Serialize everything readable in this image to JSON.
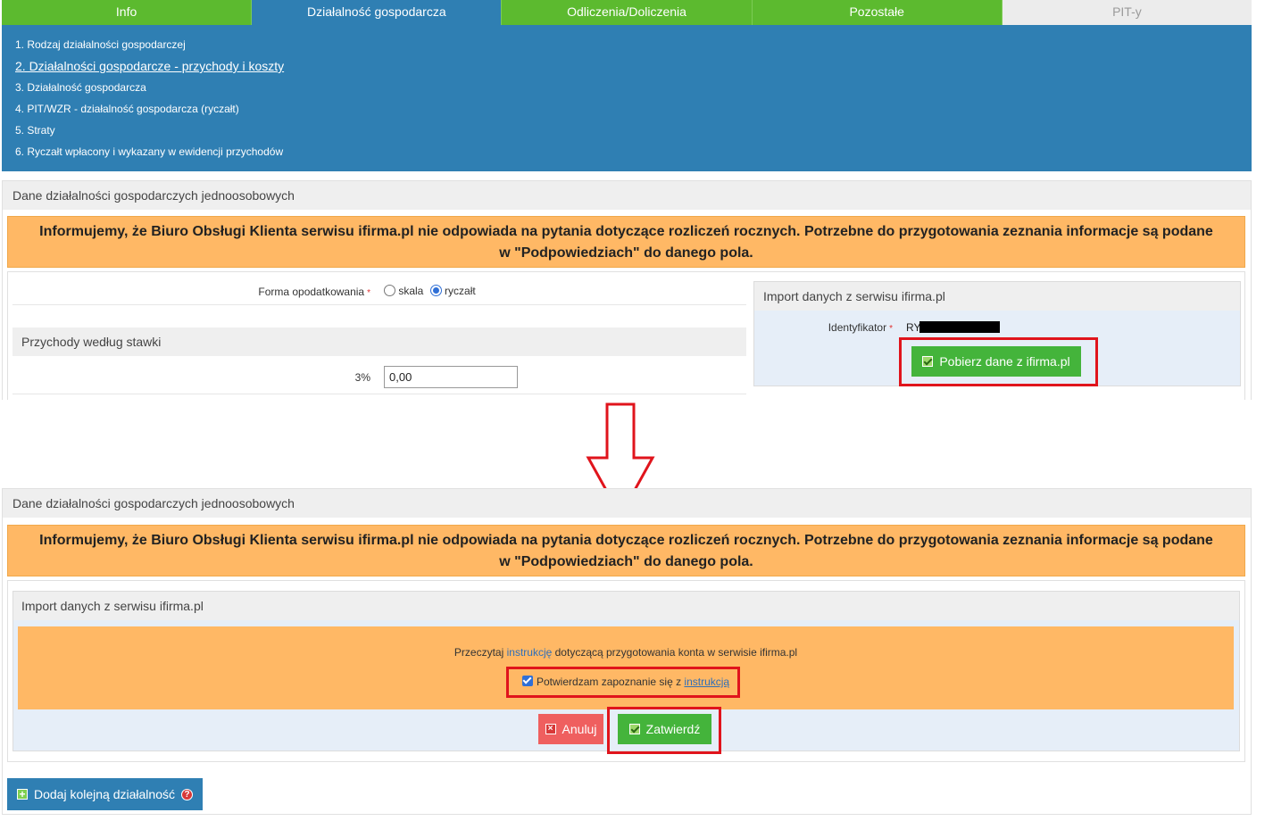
{
  "tabs": [
    {
      "label": "Info"
    },
    {
      "label": "Działalność gospodarcza"
    },
    {
      "label": "Odliczenia/Doliczenia"
    },
    {
      "label": "Pozostałe"
    },
    {
      "label": "PIT-y"
    }
  ],
  "subnav": [
    {
      "label": "1. Rodzaj działalności gospodarczej"
    },
    {
      "label": "2. Działalności gospodarcze - przychody i koszty"
    },
    {
      "label": "3. Działalność gospodarcza"
    },
    {
      "label": "4. PIT/WZR - działalność gospodarcza (ryczałt)"
    },
    {
      "label": "5. Straty"
    },
    {
      "label": "6. Ryczałt wpłacony i wykazany w ewidencji przychodów"
    }
  ],
  "top": {
    "section_title": "Dane działalności gospodarczych jednoosobowych",
    "alert": "Informujemy, że Biuro Obsługi Klienta serwisu ifirma.pl nie odpowiada na pytania dotyczące rozliczeń rocznych. Potrzebne do przygotowania zeznania informacje są podane w \"Podpowiedziach\" do danego pola.",
    "forma_label": "Forma opodatkowania",
    "option_skala": "skala",
    "option_ryczalt": "ryczałt",
    "przychody_heading": "Przychody według stawki",
    "rate_label": "3%",
    "rate_value": "0,00",
    "import_title": "Import danych z serwisu ifirma.pl",
    "identyfikator_label": "Identyfikator",
    "identyfikator_value": "RY",
    "pobierz_button": "Pobierz dane z ifirma.pl"
  },
  "bottom": {
    "section_title": "Dane działalności gospodarczych jednoosobowych",
    "alert": "Informujemy, że Biuro Obsługi Klienta serwisu ifirma.pl nie odpowiada na pytania dotyczące rozliczeń rocznych. Potrzebne do przygotowania zeznania informacje są podane w \"Podpowiedziach\" do danego pola.",
    "import_title": "Import danych z serwisu ifirma.pl",
    "read_prefix": "Przeczytaj ",
    "read_link": "instrukcję",
    "read_suffix": " dotyczącą przygotowania konta w serwisie ifirma.pl",
    "confirm_prefix": "Potwierdzam zapoznanie się z ",
    "confirm_link": "instrukcją",
    "cancel_button": "Anuluj",
    "submit_button": "Zatwierdź",
    "add_button": "Dodaj kolejną działalność",
    "help_symbol": "?"
  },
  "colors": {
    "tab_green": "#5cba2f",
    "tab_blue": "#2f7fb3",
    "alert_orange": "#ffb865",
    "highlight_red": "#e0141c",
    "button_green": "#44b43b",
    "button_red": "#ef5f5f"
  }
}
